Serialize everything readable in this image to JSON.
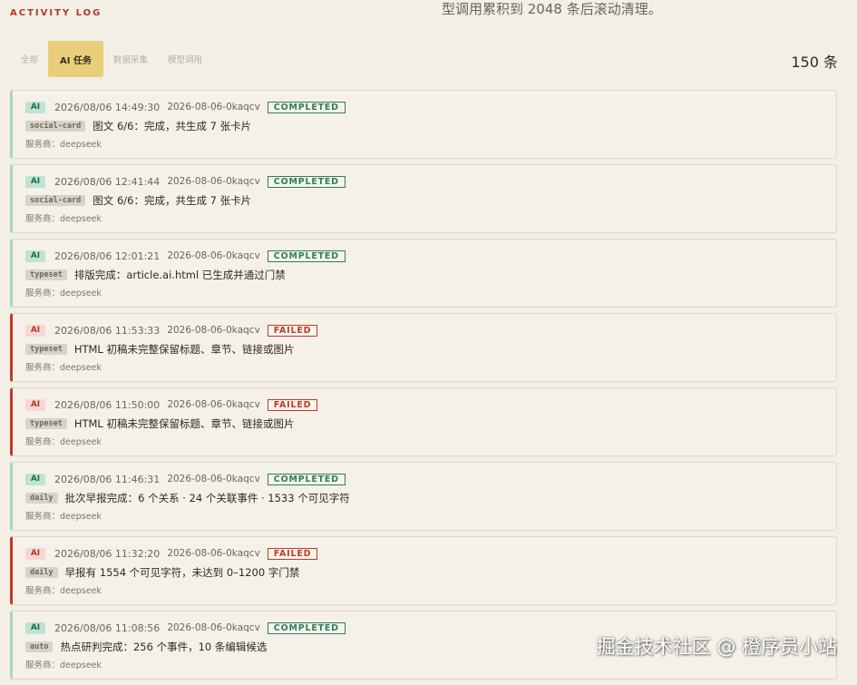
{
  "header": {
    "title": "ACTIVITY LOG",
    "note": "型调用累积到 2048 条后滚动清理。"
  },
  "tabs": [
    {
      "label": "全部",
      "active": false
    },
    {
      "label": "AI 任务",
      "active": true
    },
    {
      "label": "数据采集",
      "active": false
    },
    {
      "label": "模型调用",
      "active": false
    }
  ],
  "count_label": "150 条",
  "entries": [
    {
      "badge": "AI",
      "time": "2026/08/06 14:49:30",
      "run_id": "2026-08-06-0kaqcv",
      "status": "COMPLETED",
      "tag": "social-card",
      "message": "图文 6/6：完成，共生成 7 张卡片",
      "provider": "服务商：deepseek"
    },
    {
      "badge": "AI",
      "time": "2026/08/06 12:41:44",
      "run_id": "2026-08-06-0kaqcv",
      "status": "COMPLETED",
      "tag": "social-card",
      "message": "图文 6/6：完成，共生成 7 张卡片",
      "provider": "服务商：deepseek"
    },
    {
      "badge": "AI",
      "time": "2026/08/06 12:01:21",
      "run_id": "2026-08-06-0kaqcv",
      "status": "COMPLETED",
      "tag": "typeset",
      "message": "排版完成：article.ai.html 已生成并通过门禁",
      "provider": "服务商：deepseek"
    },
    {
      "badge": "AI",
      "time": "2026/08/06 11:53:33",
      "run_id": "2026-08-06-0kaqcv",
      "status": "FAILED",
      "tag": "typeset",
      "message": "HTML 初稿未完整保留标题、章节、链接或图片",
      "provider": "服务商：deepseek"
    },
    {
      "badge": "AI",
      "time": "2026/08/06 11:50:00",
      "run_id": "2026-08-06-0kaqcv",
      "status": "FAILED",
      "tag": "typeset",
      "message": "HTML 初稿未完整保留标题、章节、链接或图片",
      "provider": "服务商：deepseek"
    },
    {
      "badge": "AI",
      "time": "2026/08/06 11:46:31",
      "run_id": "2026-08-06-0kaqcv",
      "status": "COMPLETED",
      "tag": "daily",
      "message": "批次早报完成：6 个关系 · 24 个关联事件 · 1533 个可见字符",
      "provider": "服务商：deepseek"
    },
    {
      "badge": "AI",
      "time": "2026/08/06 11:32:20",
      "run_id": "2026-08-06-0kaqcv",
      "status": "FAILED",
      "tag": "daily",
      "message": "早报有 1554 个可见字符，未达到 0–1200 字门禁",
      "provider": "服务商：deepseek"
    },
    {
      "badge": "AI",
      "time": "2026/08/06 11:08:56",
      "run_id": "2026-08-06-0kaqcv",
      "status": "COMPLETED",
      "tag": "auto",
      "message": "热点研判完成：256 个事件，10 条编辑候选",
      "provider": "服务商：deepseek"
    }
  ],
  "watermark": "掘金技术社区 @ 橙序员小站"
}
